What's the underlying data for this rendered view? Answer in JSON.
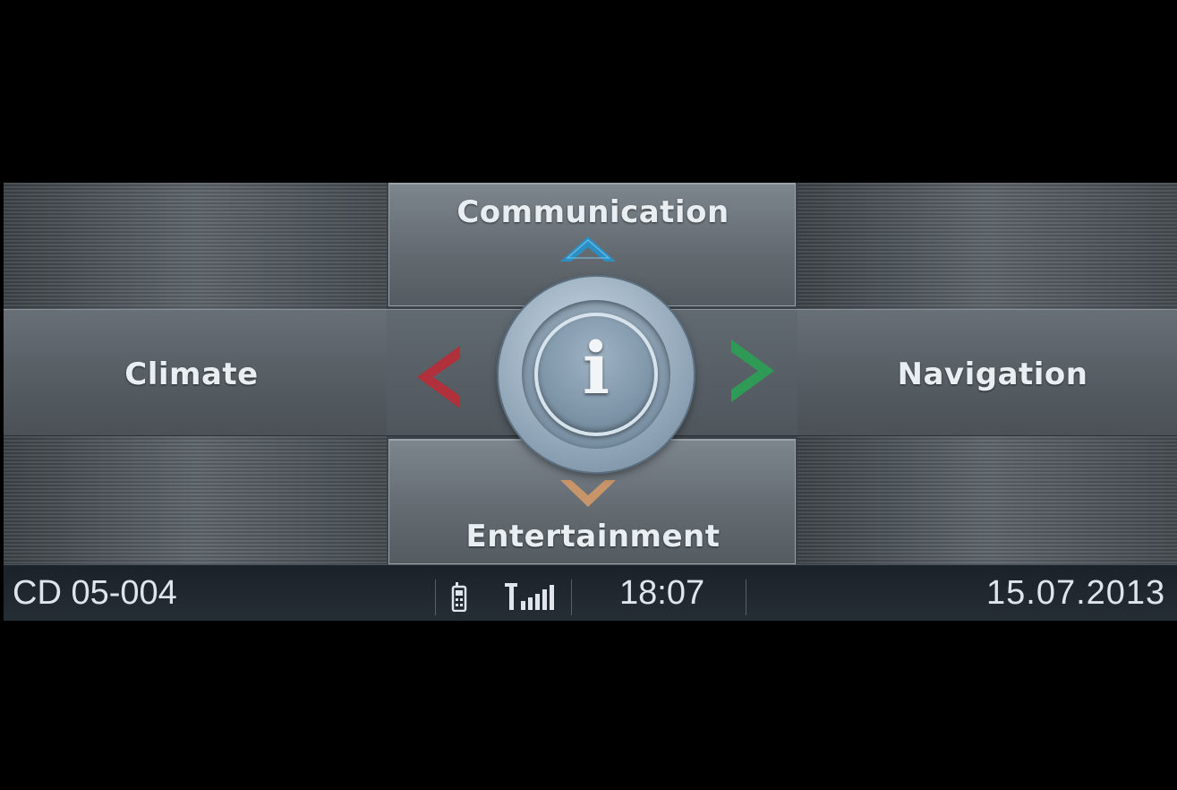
{
  "menu": {
    "top_label": "Communication",
    "left_label": "Climate",
    "right_label": "Navigation",
    "bottom_label": "Entertainment",
    "center_glyph": "i"
  },
  "status": {
    "source": "CD 05-004",
    "time": "18:07",
    "date": "15.07.2013",
    "phone_icon": "phone-icon",
    "signal_icon": "signal-strength-icon"
  },
  "colors": {
    "up_arrow": "#2c8fc4",
    "left_arrow": "#b0303c",
    "right_arrow": "#2e9a55",
    "down_arrow": "#c8956a"
  }
}
